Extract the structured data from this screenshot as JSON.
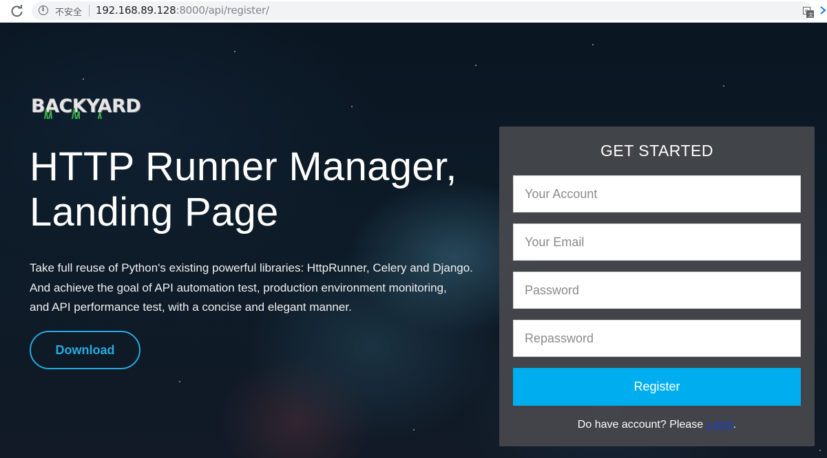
{
  "browser": {
    "security_label": "不安全",
    "url_host": "192.168.89.128",
    "url_port_path": ":8000/api/register/"
  },
  "brand": {
    "logo_text": "BACKYARD"
  },
  "hero": {
    "title_line1": "HTTP Runner Manager,",
    "title_line2": "Landing Page",
    "desc_line1": "Take full reuse of Python's existing powerful libraries: HttpRunner, Celery and Django.",
    "desc_line2": "And achieve the goal of API automation test, production environment monitoring,",
    "desc_line3": "and API performance test, with a concise and elegant manner.",
    "download_label": "Download"
  },
  "form": {
    "title": "GET STARTED",
    "account_placeholder": "Your Account",
    "email_placeholder": "Your Email",
    "password_placeholder": "Password",
    "repassword_placeholder": "Repassword",
    "register_label": "Register",
    "login_prompt_before": "Do have account? Please ",
    "login_link": "Login",
    "login_prompt_after": "."
  },
  "colors": {
    "accent": "#00aeef",
    "download_border": "#27aae1",
    "panel_bg": "#46484c"
  }
}
